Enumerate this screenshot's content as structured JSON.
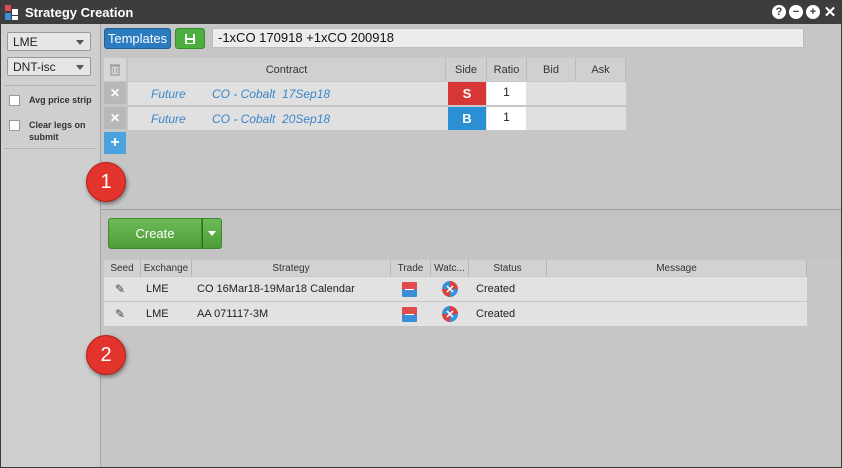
{
  "window": {
    "title": "Strategy Creation"
  },
  "sidebar": {
    "exchange_value": "LME",
    "account_value": "DNT-isc",
    "options": [
      {
        "label": "Avg price strip"
      },
      {
        "label": "Clear legs on submit"
      }
    ]
  },
  "toolbar": {
    "templates_label": "Templates",
    "strategy_text": "-1xCO 170918 +1xCO 200918"
  },
  "legs": {
    "headers": [
      "Contract",
      "Side",
      "Ratio",
      "Bid",
      "Ask"
    ],
    "rows": [
      {
        "type": "Future",
        "contract": "CO - Cobalt  17Sep18",
        "side": "S",
        "ratio": "1"
      },
      {
        "type": "Future",
        "contract": "CO - Cobalt  20Sep18",
        "side": "B",
        "ratio": "1"
      }
    ]
  },
  "badges": {
    "one": "1",
    "two": "2"
  },
  "create": {
    "label": "Create"
  },
  "strategies": {
    "headers": [
      "Seed",
      "Exchange",
      "Strategy",
      "Trade",
      "Watc...",
      "Status",
      "Message"
    ],
    "rows": [
      {
        "exchange": "LME",
        "strategy": "CO 16Mar18-19Mar18 Calendar",
        "status": "Created"
      },
      {
        "exchange": "LME",
        "strategy": "AA 071117-3M",
        "status": "Created"
      }
    ]
  },
  "colors": {
    "title_bar": "#3d3d3d",
    "templates_button": "#2a7bbf",
    "save_button": "#4caf3f",
    "sell": "#d63636",
    "buy": "#2b8fd3",
    "create_button": "#5aab45",
    "badge": "#e3332d"
  }
}
